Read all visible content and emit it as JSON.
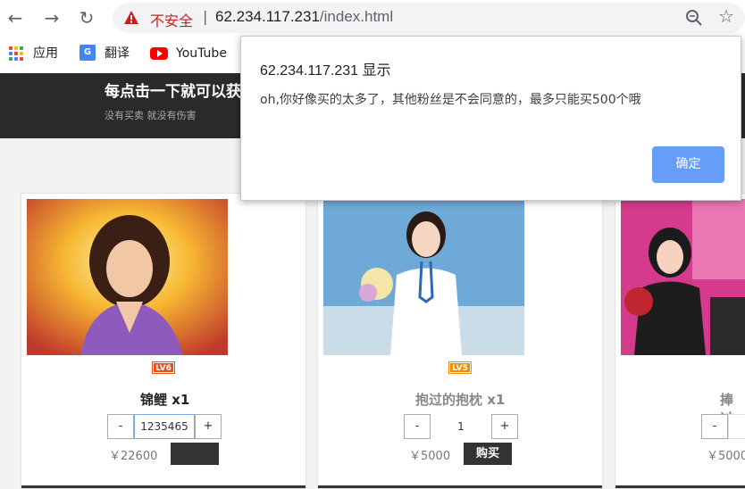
{
  "browser": {
    "insecure_label": "不安全",
    "separator": "|",
    "url_host": "62.234.117.231",
    "url_path": "/index.html",
    "bookmarks": [
      {
        "label": "应用",
        "icon": "apps-grid-icon"
      },
      {
        "label": "翻译",
        "icon": "translate-icon"
      },
      {
        "label": "YouTube",
        "icon": "youtube-icon"
      }
    ]
  },
  "banner": {
    "title": "每点击一下就可以获",
    "subtitle": "没有买卖 就没有伤害"
  },
  "products": [
    {
      "name": "锦鲤 x1",
      "level": "LV6",
      "quantity": "1235465",
      "price": "￥22600",
      "buy_label": "",
      "image": "portrait-praying"
    },
    {
      "name": "抱过的抱枕 x1",
      "level": "LV5",
      "quantity": "1",
      "price": "￥5000",
      "buy_label": "购买",
      "image": "portrait-flowers"
    },
    {
      "name": "捧过",
      "level": "",
      "quantity": "",
      "price": "￥5000",
      "buy_label": "",
      "image": "portrait-stage"
    }
  ],
  "stepper": {
    "minus": "-",
    "plus": "+"
  },
  "dialog": {
    "title": "62.234.117.231 显示",
    "message": "oh,你好像买的太多了，其他粉丝是不会同意的，最多只能买500个哦",
    "ok_label": "确定"
  },
  "colors": {
    "dialog_ok": "#669df6",
    "banner_bg": "#2a2a2a",
    "insecure": "#c5221f"
  }
}
